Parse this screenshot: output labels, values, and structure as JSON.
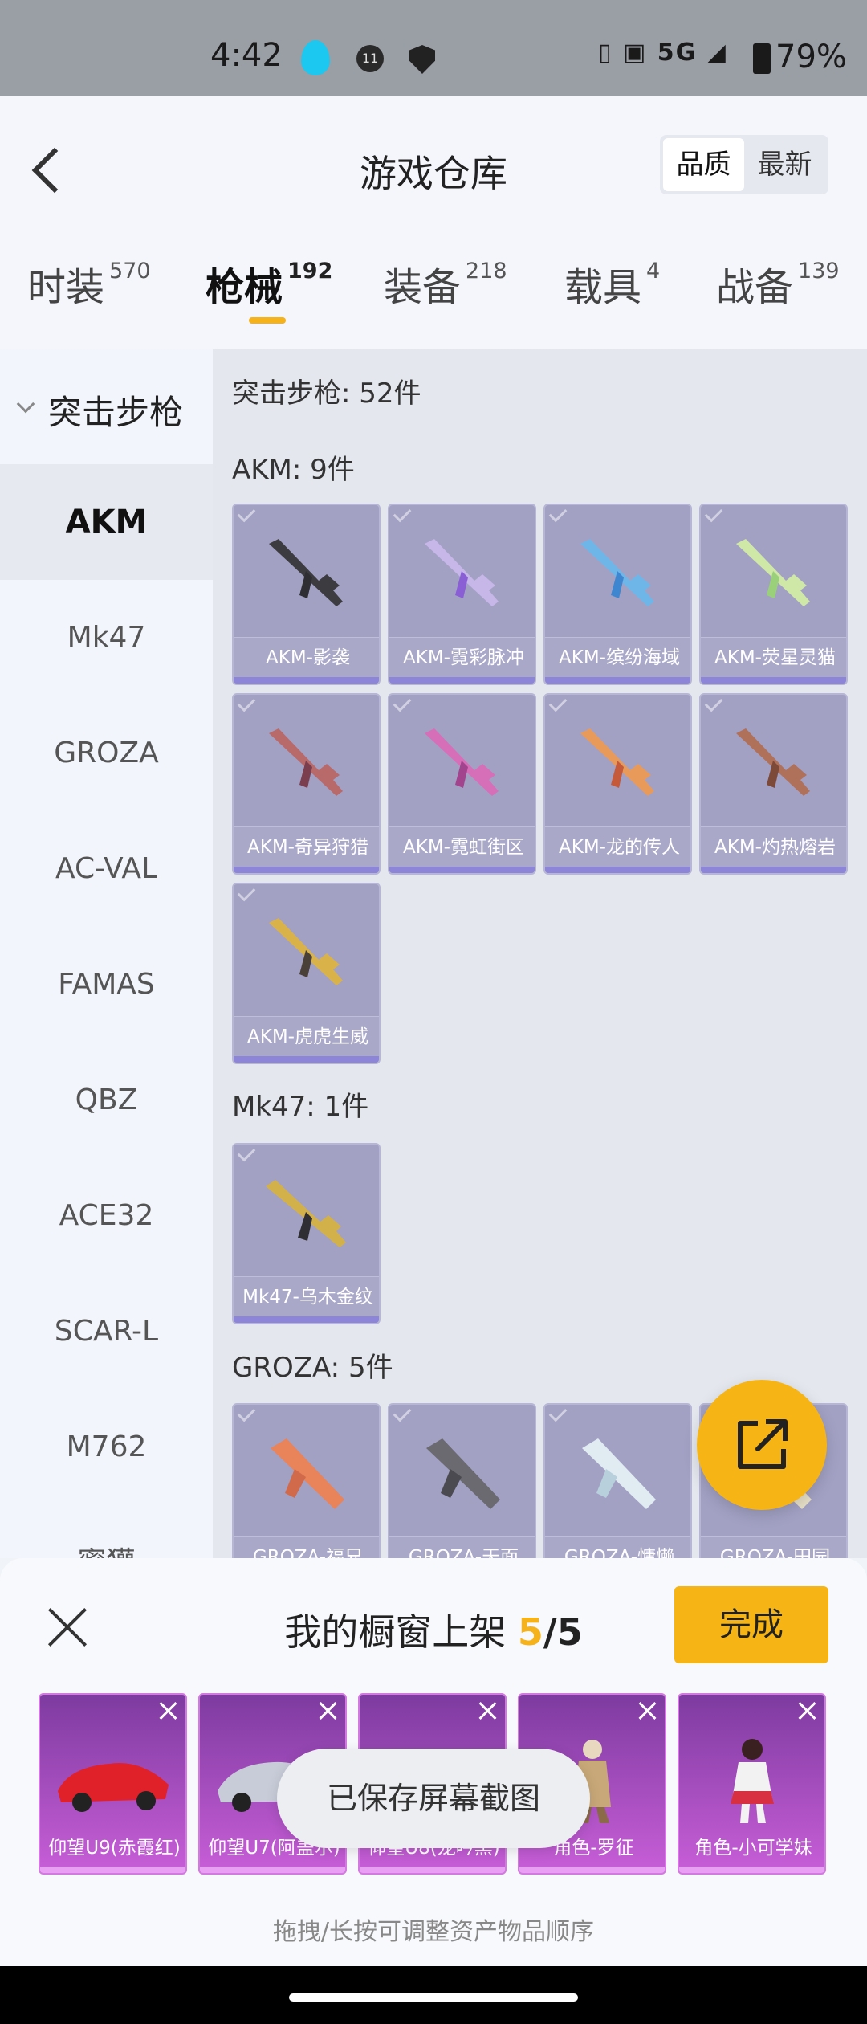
{
  "status_bar": {
    "time": "4:42",
    "notification_count": "11",
    "network": "5G",
    "battery": "79%"
  },
  "header": {
    "title": "游戏仓库",
    "sort_options": [
      "品质",
      "最新"
    ],
    "active_sort": "品质"
  },
  "tabs": [
    {
      "label": "时装",
      "count": "570"
    },
    {
      "label": "枪械",
      "count": "192"
    },
    {
      "label": "装备",
      "count": "218"
    },
    {
      "label": "载具",
      "count": "4"
    },
    {
      "label": "战备",
      "count": "139"
    }
  ],
  "active_tab": "枪械",
  "sidebar": {
    "group": "突击步枪",
    "items": [
      "AKM",
      "Mk47",
      "GROZA",
      "AC-VAL",
      "FAMAS",
      "QBZ",
      "ACE32",
      "SCAR-L",
      "M762",
      "蜜獾"
    ],
    "active": "AKM"
  },
  "content": {
    "category_summary": "突击步枪: 52件",
    "sections": [
      {
        "title": "AKM: 9件",
        "items": [
          "AKM-影袭",
          "AKM-霓彩脉冲",
          "AKM-缤纷海域",
          "AKM-荧星灵猫",
          "AKM-奇异狩猎",
          "AKM-霓虹街区",
          "AKM-龙的传人",
          "AKM-灼热熔岩",
          "AKM-虎虎生威"
        ]
      },
      {
        "title": "Mk47: 1件",
        "items": [
          "Mk47-乌木金纹"
        ]
      },
      {
        "title": "GROZA: 5件",
        "items": [
          "GROZA-福兄",
          "GROZA-天面",
          "GROZA-慵懒",
          "GROZA-田园"
        ]
      }
    ]
  },
  "showcase": {
    "title": "我的橱窗上架",
    "current": "5",
    "max": "/5",
    "done_label": "完成",
    "items": [
      "仰望U9(赤霞红)",
      "仰望U7(阿盖尔)",
      "仰望U8(龙吟黑)",
      "角色-罗征",
      "角色-小可学妹"
    ],
    "hint": "拖拽/长按可调整资产物品顺序"
  },
  "toast": "已保存屏幕截图",
  "colors": {
    "accent": "#f7b515",
    "card": "#a2a1c4",
    "showcase_card": "#b350c8"
  }
}
